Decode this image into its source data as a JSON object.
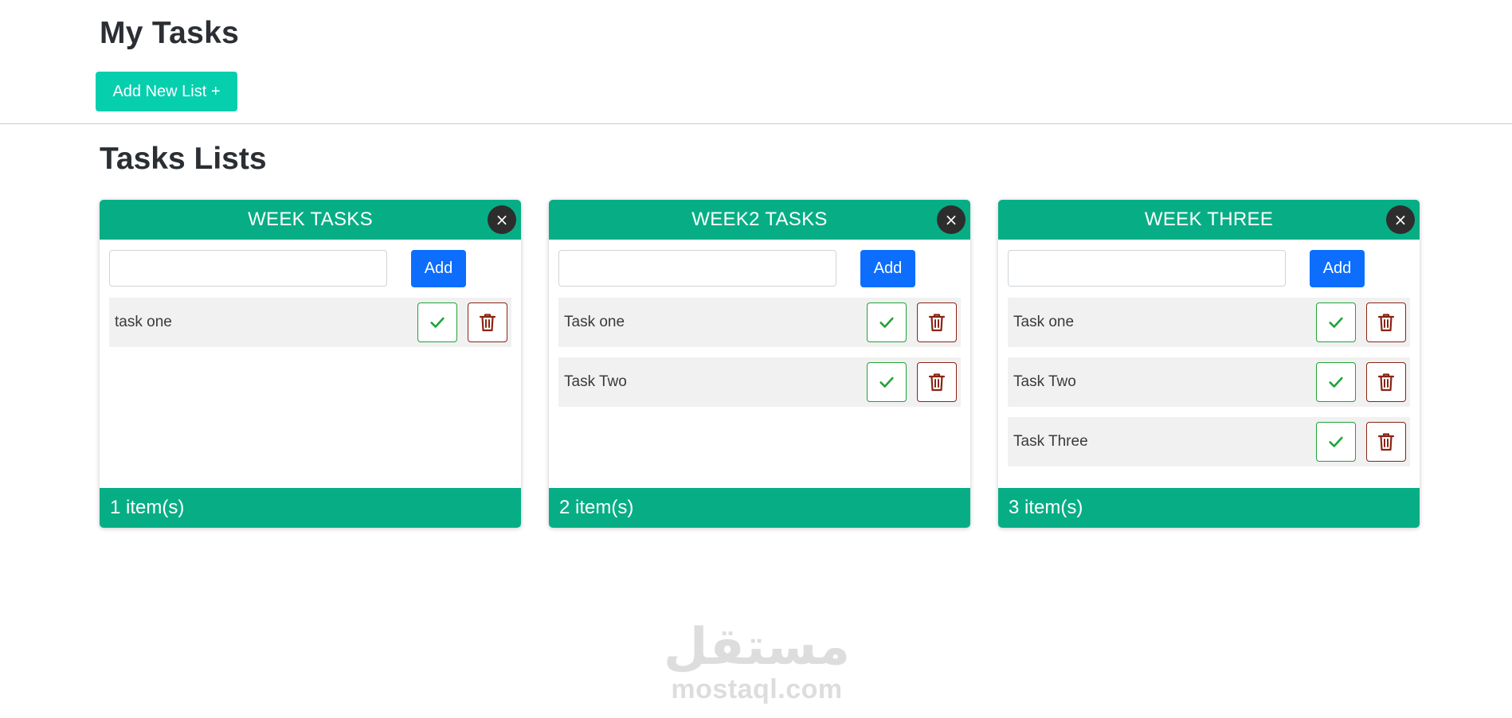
{
  "header": {
    "title": "My Tasks",
    "add_list_label": "Add New List +"
  },
  "section": {
    "title": "Tasks Lists"
  },
  "add_button_label": "Add",
  "close_glyph": "×",
  "icons": {
    "check": "check-icon",
    "delete": "trash-icon"
  },
  "colors": {
    "primary_teal": "#07ae85",
    "add_list_teal": "#06cfae",
    "add_blue": "#0d6efd",
    "check_green": "#1fa337",
    "delete_red": "#8a2414",
    "row_gray": "#f1f1f1"
  },
  "lists": [
    {
      "title": "WEEK TASKS",
      "input_value": "",
      "tasks": [
        {
          "text": "task one"
        }
      ],
      "footer": "1 item(s)"
    },
    {
      "title": "WEEK2 TASKS",
      "input_value": "",
      "tasks": [
        {
          "text": "Task one"
        },
        {
          "text": "Task Two"
        }
      ],
      "footer": "2 item(s)"
    },
    {
      "title": "WEEK THREE",
      "input_value": "",
      "tasks": [
        {
          "text": "Task one"
        },
        {
          "text": "Task Two"
        },
        {
          "text": "Task Three"
        }
      ],
      "footer": "3 item(s)"
    }
  ],
  "watermark": {
    "logo": "مستقل",
    "text": "mostaql.com"
  }
}
